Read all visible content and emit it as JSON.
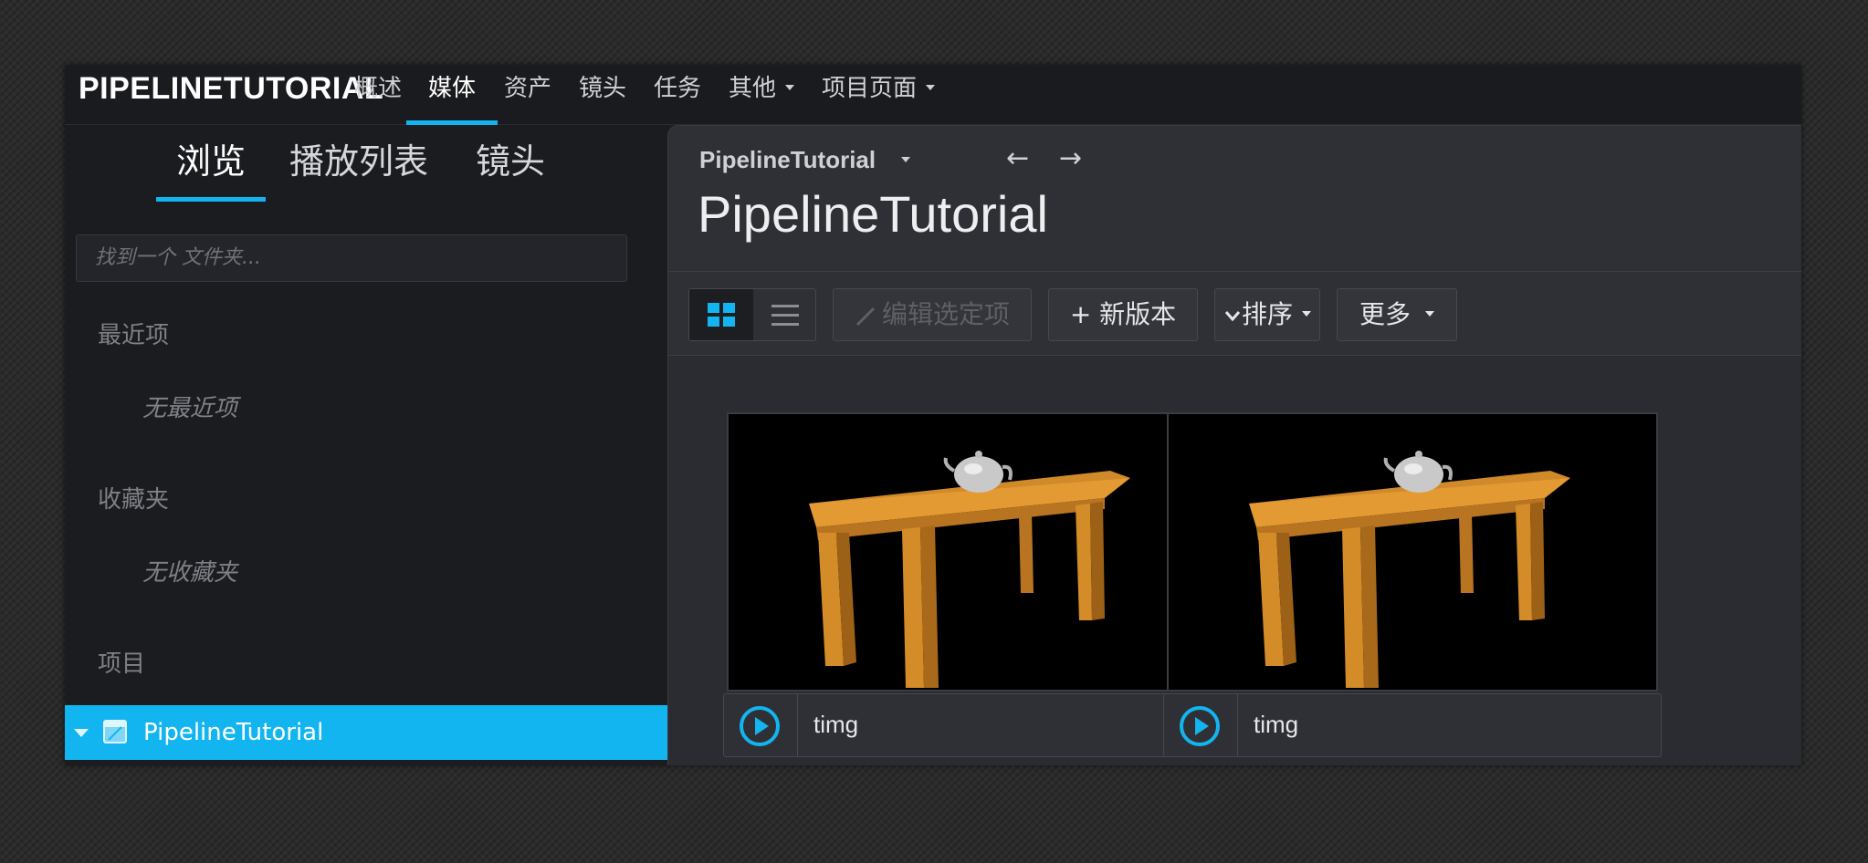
{
  "brand": "PIPELINETUTORIAL",
  "nav": [
    {
      "label": "概述",
      "dropdown": false,
      "active": false
    },
    {
      "label": "媒体",
      "dropdown": false,
      "active": true
    },
    {
      "label": "资产",
      "dropdown": false,
      "active": false
    },
    {
      "label": "镜头",
      "dropdown": false,
      "active": false
    },
    {
      "label": "任务",
      "dropdown": false,
      "active": false
    },
    {
      "label": "其他",
      "dropdown": true,
      "active": false
    },
    {
      "label": "项目页面",
      "dropdown": true,
      "active": false
    }
  ],
  "sidebar": {
    "tabs": [
      "浏览",
      "播放列表",
      "镜头"
    ],
    "active_tab": "浏览",
    "search_placeholder": "找到一个 文件夹...",
    "recent_title": "最近项",
    "recent_empty": "无最近项",
    "favorites_title": "收藏夹",
    "favorites_empty": "无收藏夹",
    "projects_title": "项目",
    "project_item": "PipelineTutorial"
  },
  "main": {
    "breadcrumb": "PipelineTutorial",
    "back_icon": "arrow-left-icon",
    "forward_icon": "arrow-right-icon",
    "title": "PipelineTutorial",
    "toolbar": {
      "grid_view_icon": "grid-icon",
      "list_view_icon": "list-icon",
      "edit_label": "编辑选定项",
      "new_version_label": "+ 新版本",
      "sort_label": "排序",
      "more_label": "更多"
    },
    "cards": [
      {
        "name": "timg"
      },
      {
        "name": "timg"
      }
    ]
  },
  "colors": {
    "accent": "#12b5ef",
    "background": "#1b1c20",
    "panel": "#2a2b30"
  }
}
